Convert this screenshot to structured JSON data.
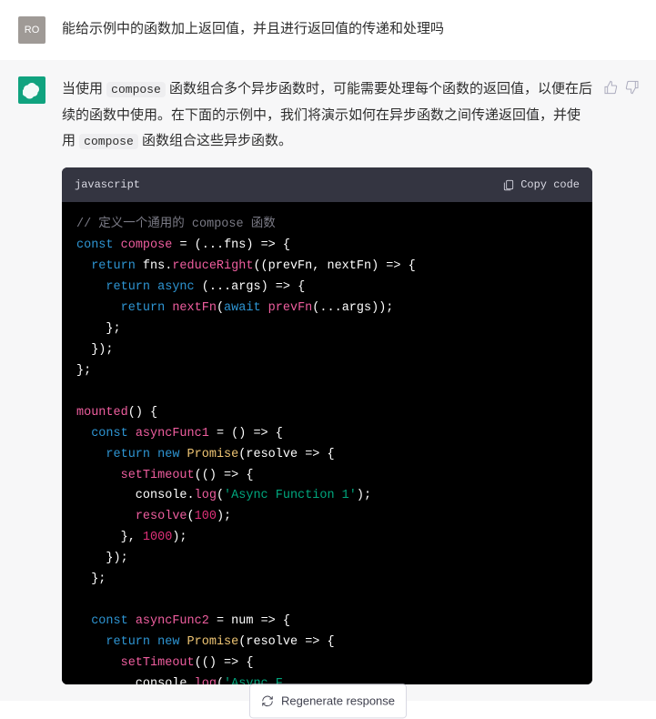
{
  "user": {
    "avatar_label": "RO",
    "message": "能给示例中的函数加上返回值，并且进行返回值的传递和处理吗"
  },
  "assistant": {
    "reply_pre1": "当使用 ",
    "reply_code1": "compose",
    "reply_mid1": " 函数组合多个异步函数时，可能需要处理每个函数的返回值，以便在后续的函数中使用。在下面的示例中，我们将演示如何在异步函数之间传递返回值，并使用 ",
    "reply_code2": "compose",
    "reply_post1": " 函数组合这些异步函数。"
  },
  "code": {
    "lang": "javascript",
    "copy_label": "Copy code",
    "comment1": "// 定义一个通用的 compose 函数",
    "str_async1": "'Async Function 1'",
    "num_100": "100",
    "num_1000": "1000"
  },
  "regen_label": "Regenerate response"
}
